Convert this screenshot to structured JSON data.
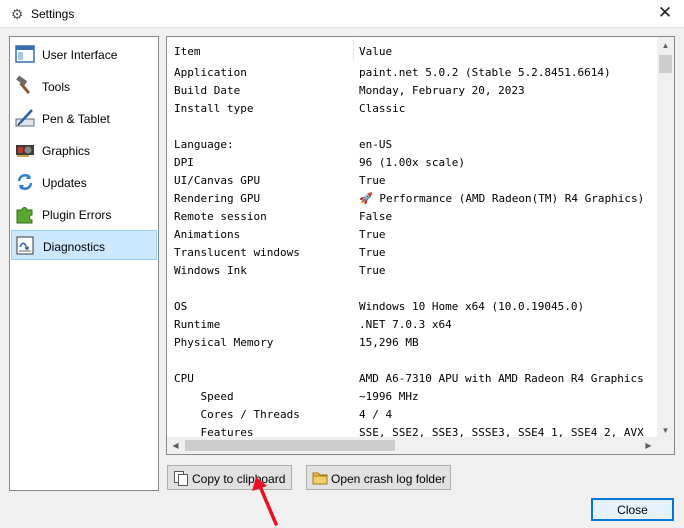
{
  "window": {
    "title": "Settings",
    "icon": "gear-icon",
    "close_glyph": "✕"
  },
  "sidebar": {
    "items": [
      {
        "label": "User Interface",
        "icon": "window-icon",
        "selected": false
      },
      {
        "label": "Tools",
        "icon": "hammer-icon",
        "selected": false
      },
      {
        "label": "Pen & Tablet",
        "icon": "pen-tablet-icon",
        "selected": false
      },
      {
        "label": "Graphics",
        "icon": "graphics-card-icon",
        "selected": false
      },
      {
        "label": "Updates",
        "icon": "refresh-icon",
        "selected": false
      },
      {
        "label": "Plugin Errors",
        "icon": "puzzle-icon",
        "selected": false
      },
      {
        "label": "Diagnostics",
        "icon": "diagnostics-icon",
        "selected": true
      }
    ]
  },
  "diagnostics": {
    "columns": {
      "item": "Item",
      "value": "Value"
    },
    "rows": [
      {
        "item": "Application",
        "value": "paint.net 5.0.2 (Stable 5.2.8451.6614)"
      },
      {
        "item": "Build Date",
        "value": "Monday, February 20, 2023"
      },
      {
        "item": "Install type",
        "value": "Classic"
      },
      {
        "item": "",
        "value": ""
      },
      {
        "item": "Language:",
        "value": "en-US"
      },
      {
        "item": "DPI",
        "value": "96 (1.00x scale)"
      },
      {
        "item": "UI/Canvas GPU",
        "value": "True"
      },
      {
        "item": "Rendering GPU",
        "value": "🚀 Performance (AMD Radeon(TM) R4 Graphics)"
      },
      {
        "item": "Remote session",
        "value": "False"
      },
      {
        "item": "Animations",
        "value": "True"
      },
      {
        "item": "Translucent windows",
        "value": "True"
      },
      {
        "item": "Windows Ink",
        "value": "True"
      },
      {
        "item": "",
        "value": ""
      },
      {
        "item": "OS",
        "value": "Windows 10 Home x64 (10.0.19045.0)"
      },
      {
        "item": "Runtime",
        "value": ".NET 7.0.3 x64"
      },
      {
        "item": "Physical Memory",
        "value": "15,296 MB"
      },
      {
        "item": "",
        "value": ""
      },
      {
        "item": "CPU",
        "value": "AMD A6-7310 APU with AMD Radeon R4 Graphics"
      },
      {
        "item": "    Speed",
        "value": "~1996 MHz"
      },
      {
        "item": "    Cores / Threads",
        "value": "4 / 4"
      },
      {
        "item": "    Features",
        "value": "SSE, SSE2, SSE3, SSSE3, SSE4_1, SSE4_2, AVX"
      }
    ]
  },
  "buttons": {
    "copy_label": "Copy to clipboard",
    "crash_label": "Open crash log folder",
    "close_label": "Close"
  },
  "colors": {
    "selection_bg": "#cce8ff",
    "selection_border": "#99d1ff",
    "annotation_arrow": "#e81123",
    "default_button_border": "#0078d7"
  }
}
